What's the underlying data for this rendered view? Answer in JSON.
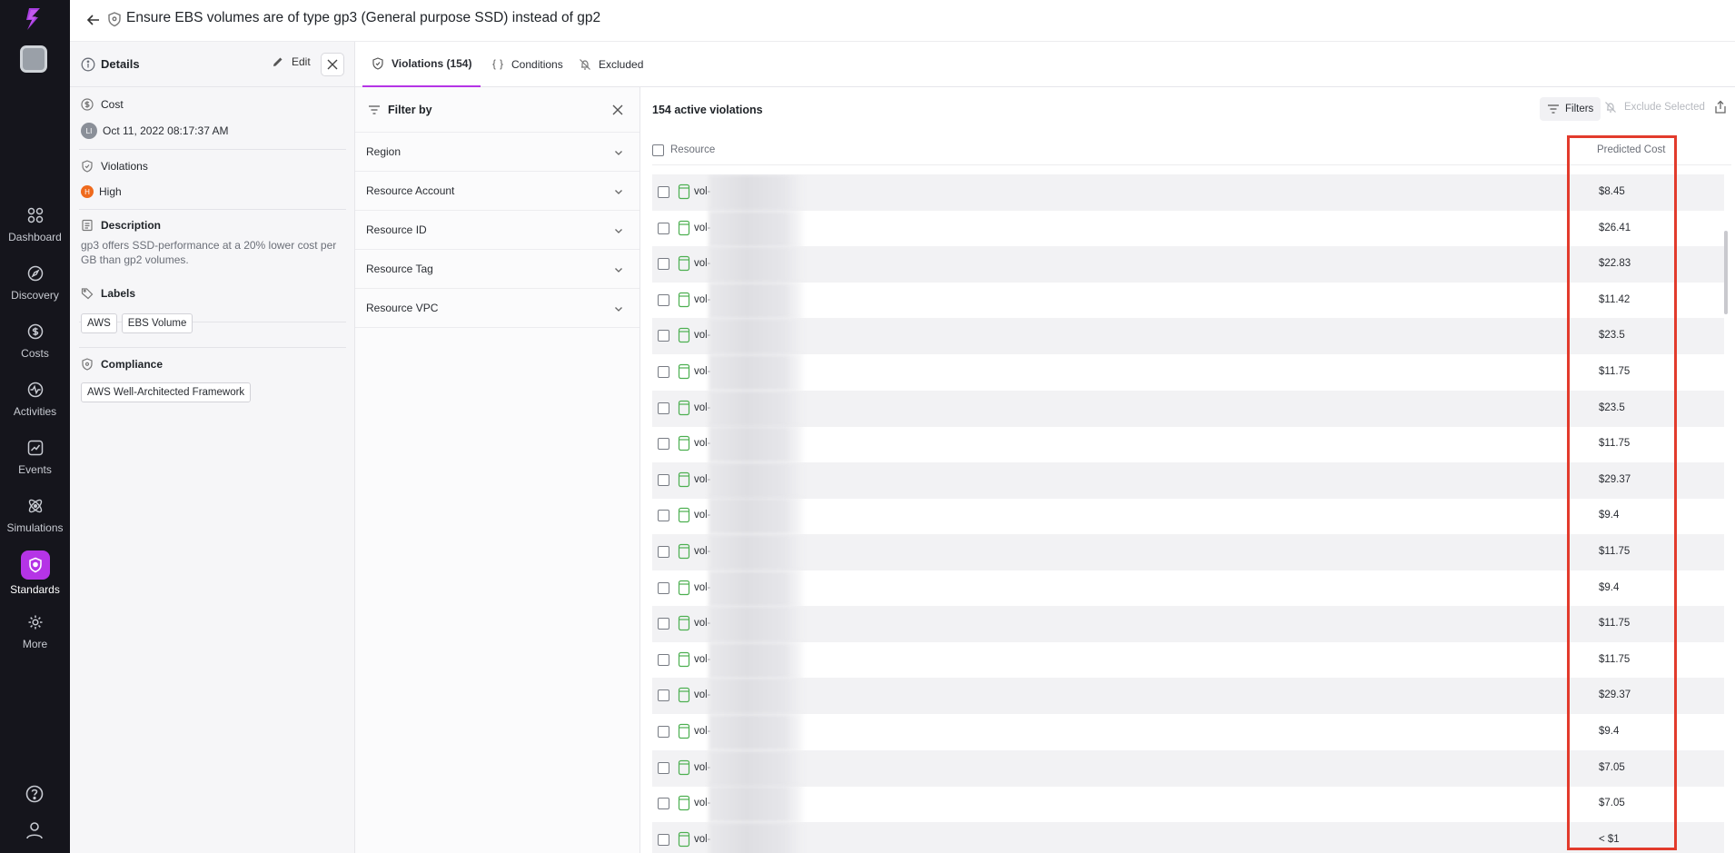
{
  "nav": {
    "items": [
      {
        "label": "Dashboard",
        "icon": "grid-icon"
      },
      {
        "label": "Discovery",
        "icon": "compass-icon"
      },
      {
        "label": "Costs",
        "icon": "dollar-icon"
      },
      {
        "label": "Activities",
        "icon": "activity-icon"
      },
      {
        "label": "Events",
        "icon": "chart-icon"
      },
      {
        "label": "Simulations",
        "icon": "atom-icon"
      },
      {
        "label": "Standards",
        "icon": "shield-icon"
      },
      {
        "label": "More",
        "icon": "gear-icon"
      }
    ],
    "active": "Standards",
    "accent": "#b534e6"
  },
  "header": {
    "title": "Ensure EBS volumes are of type gp3 (General purpose SSD) instead of gp2"
  },
  "details": {
    "heading": "Details",
    "edit_label": "Edit",
    "cost_label": "Cost",
    "owner_initials": "LI",
    "cost_date": "Oct 11, 2022 08:17:37 AM",
    "violations_label": "Violations",
    "severity_badge": "H",
    "severity": "High",
    "description_label": "Description",
    "description": "gp3 offers SSD-performance at a 20% lower cost per GB than gp2 volumes.",
    "labels_label": "Labels",
    "labels": [
      "AWS",
      "EBS Volume"
    ],
    "compliance_label": "Compliance",
    "compliance": [
      "AWS Well-Architected Framework"
    ]
  },
  "tabs": [
    {
      "label": "Violations (154)",
      "active": true
    },
    {
      "label": "Conditions",
      "active": false
    },
    {
      "label": "Excluded",
      "active": false
    }
  ],
  "filter": {
    "heading": "Filter by",
    "facets": [
      "Region",
      "Resource Account",
      "Resource ID",
      "Resource Tag",
      "Resource VPC"
    ]
  },
  "table": {
    "count_label": "154 active violations",
    "filters_label": "Filters",
    "exclude_label": "Exclude Selected",
    "columns": {
      "resource": "Resource",
      "predicted_cost": "Predicted Cost"
    },
    "rows": [
      {
        "id": "vol-",
        "cost": "$8.45"
      },
      {
        "id": "vol-",
        "cost": "$26.41"
      },
      {
        "id": "vol-",
        "cost": "$22.83"
      },
      {
        "id": "vol-",
        "cost": "$11.42"
      },
      {
        "id": "vol-",
        "cost": "$23.5"
      },
      {
        "id": "vol-",
        "cost": "$11.75"
      },
      {
        "id": "vol-",
        "cost": "$23.5"
      },
      {
        "id": "vol-",
        "cost": "$11.75"
      },
      {
        "id": "vol-",
        "cost": "$29.37"
      },
      {
        "id": "vol-",
        "cost": "$9.4"
      },
      {
        "id": "vol-",
        "cost": "$11.75"
      },
      {
        "id": "vol-",
        "cost": "$9.4"
      },
      {
        "id": "vol-",
        "cost": "$11.75"
      },
      {
        "id": "vol-",
        "cost": "$11.75"
      },
      {
        "id": "vol-",
        "cost": "$29.37"
      },
      {
        "id": "vol-",
        "cost": "$9.4"
      },
      {
        "id": "vol-",
        "cost": "$7.05"
      },
      {
        "id": "vol-",
        "cost": "$7.05"
      },
      {
        "id": "vol-",
        "cost": "< $1"
      }
    ]
  },
  "colors": {
    "highlight": "#e23b2c",
    "severity_high": "#ef6a1d",
    "volume_icon": "#4caf50"
  }
}
